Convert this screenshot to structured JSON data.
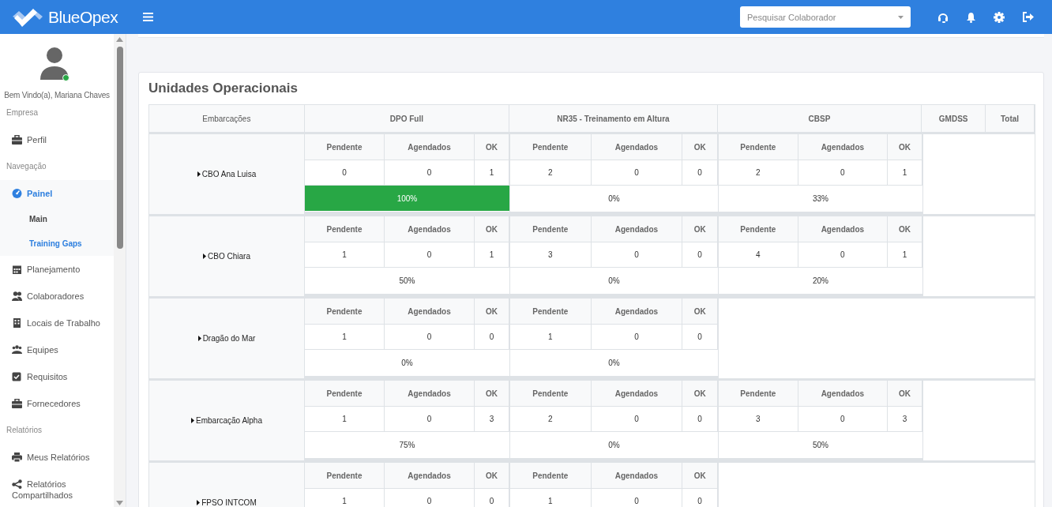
{
  "header": {
    "brand": "BlueOpex",
    "search": {
      "placeholder": "Pesquisar Colaborador"
    }
  },
  "sidebar": {
    "user": {
      "greeting": "Bem Vindo(a), Mariana Chaves",
      "online": true
    },
    "sections": [
      {
        "title": "Empresa",
        "items": [
          {
            "label": "Perfil",
            "expanded": false
          }
        ]
      },
      {
        "title": "Navegação",
        "items": [
          {
            "label": "Painel",
            "expanded": true,
            "children": [
              {
                "label": "Main",
                "selected": false
              },
              {
                "label": "Training Gaps",
                "selected": true
              }
            ]
          },
          {
            "label": "Planejamento",
            "expanded": false
          },
          {
            "label": "Colaboradores",
            "expanded": false
          },
          {
            "label": "Locais de Trabalho",
            "expanded": false
          },
          {
            "label": "Equipes",
            "expanded": false
          },
          {
            "label": "Requisitos",
            "expanded": false
          },
          {
            "label": "Fornecedores",
            "expanded": false
          }
        ]
      },
      {
        "title": "Relatórios",
        "items": [
          {
            "label": "Meus Relatórios",
            "expanded": false
          },
          {
            "label": "Relatórios Compartilhados",
            "expanded": false
          }
        ]
      }
    ]
  },
  "card": {
    "title": "Unidades Operacionais",
    "table": {
      "columns": [
        "Embarcações",
        "DPO Full",
        "NR35 - Treinamento em Altura",
        "CBSP",
        "GMDSS",
        "Total"
      ],
      "rows": [
        {
          "vessel": "CBO Ana Luisa",
          "courses": [
            {
              "headers": [
                "Pendente",
                "Agendados",
                "OK"
              ],
              "values": [
                "0",
                "0",
                "1"
              ],
              "percent": "100%",
              "highlight": true
            },
            {
              "headers": [
                "Pendente",
                "Agendados",
                "OK"
              ],
              "values": [
                "2",
                "0",
                "0"
              ],
              "percent": "0%",
              "highlight": false
            },
            {
              "headers": [
                "Pendente",
                "Agendados",
                "OK"
              ],
              "values": [
                "2",
                "0",
                "1"
              ],
              "percent": "33%",
              "highlight": false
            }
          ]
        },
        {
          "vessel": "CBO Chiara",
          "courses": [
            {
              "headers": [
                "Pendente",
                "Agendados",
                "OK"
              ],
              "values": [
                "1",
                "0",
                "1"
              ],
              "percent": "50%",
              "highlight": false
            },
            {
              "headers": [
                "Pendente",
                "Agendados",
                "OK"
              ],
              "values": [
                "3",
                "0",
                "0"
              ],
              "percent": "0%",
              "highlight": false
            },
            {
              "headers": [
                "Pendente",
                "Agendados",
                "OK"
              ],
              "values": [
                "4",
                "0",
                "1"
              ],
              "percent": "20%",
              "highlight": false
            }
          ]
        },
        {
          "vessel": "Dragão do Mar",
          "courses": [
            {
              "headers": [
                "Pendente",
                "Agendados",
                "OK"
              ],
              "values": [
                "1",
                "0",
                "0"
              ],
              "percent": "0%",
              "highlight": false
            },
            {
              "headers": [
                "Pendente",
                "Agendados",
                "OK"
              ],
              "values": [
                "1",
                "0",
                "0"
              ],
              "percent": "0%",
              "highlight": false
            }
          ]
        },
        {
          "vessel": "Embarcação Alpha",
          "courses": [
            {
              "headers": [
                "Pendente",
                "Agendados",
                "OK"
              ],
              "values": [
                "1",
                "0",
                "3"
              ],
              "percent": "75%",
              "highlight": false
            },
            {
              "headers": [
                "Pendente",
                "Agendados",
                "OK"
              ],
              "values": [
                "2",
                "0",
                "0"
              ],
              "percent": "0%",
              "highlight": false
            },
            {
              "headers": [
                "Pendente",
                "Agendados",
                "OK"
              ],
              "values": [
                "3",
                "0",
                "3"
              ],
              "percent": "50%",
              "highlight": false
            }
          ]
        },
        {
          "vessel": "FPSO INTCOM",
          "courses": [
            {
              "headers": [
                "Pendente",
                "Agendados",
                "OK"
              ],
              "values": [
                "1",
                "0",
                "0"
              ]
            },
            {
              "headers": [
                "Pendente",
                "Agendados",
                "OK"
              ],
              "values": [
                "1",
                "0",
                "0"
              ]
            }
          ]
        }
      ]
    }
  }
}
